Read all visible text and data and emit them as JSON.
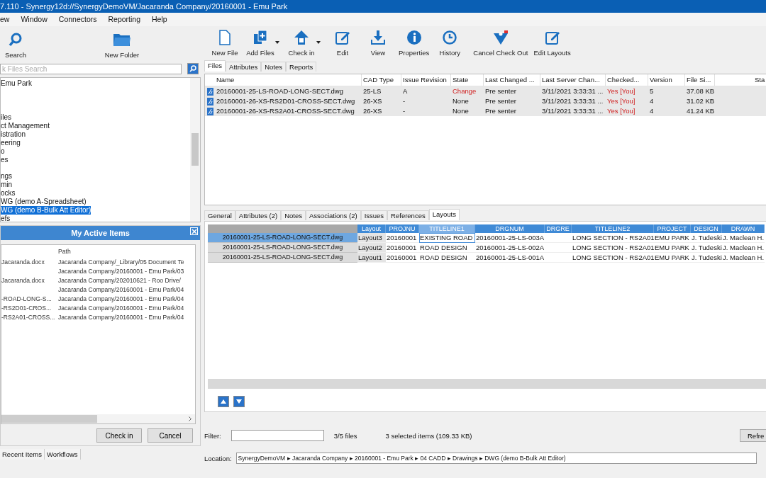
{
  "window": {
    "title": "7.110 - Synergy12d://SynergyDemoVM/Jacaranda Company/20160001 - Emu Park"
  },
  "menu": [
    "ew",
    "Window",
    "Connectors",
    "Reporting",
    "Help"
  ],
  "toolbar_left": [
    {
      "label": "Search",
      "kind": "search"
    },
    {
      "label": "New Folder",
      "kind": "folder"
    }
  ],
  "toolbar": [
    {
      "label": "New File",
      "kind": "file",
      "dropdown": false
    },
    {
      "label": "Add Files",
      "kind": "addfiles",
      "dropdown": true
    },
    {
      "label": "Check in",
      "kind": "checkin",
      "dropdown": true
    },
    {
      "label": "Edit",
      "kind": "edit",
      "dropdown": false
    },
    {
      "label": "View",
      "kind": "download",
      "dropdown": false
    },
    {
      "label": "Properties",
      "kind": "info",
      "dropdown": false
    },
    {
      "label": "History",
      "kind": "history",
      "dropdown": false
    },
    {
      "label": "Cancel Check Out",
      "kind": "cancel",
      "dropdown": false
    },
    {
      "label": "Edit Layouts",
      "kind": "edit",
      "dropdown": false
    }
  ],
  "quick_search": {
    "placeholder": "k Files Search"
  },
  "tree": [
    {
      "label": "Emu Park",
      "selected": false
    },
    {
      "label": "iles",
      "selected": false
    },
    {
      "label": "ct Management",
      "selected": false
    },
    {
      "label": "istration",
      "selected": false
    },
    {
      "label": "eering",
      "selected": false
    },
    {
      "label": "o",
      "selected": false
    },
    {
      "label": "es",
      "selected": false
    },
    {
      "label": "ngs",
      "selected": false
    },
    {
      "label": "min",
      "selected": false
    },
    {
      "label": "ocks",
      "selected": false
    },
    {
      "label": "WG (demo A-Spreadsheet)",
      "selected": false
    },
    {
      "label": "WG (demo B-Bulk Att Editor)",
      "selected": true
    },
    {
      "label": "efs",
      "selected": false
    }
  ],
  "active_items": {
    "title": "My Active Items",
    "columns": [
      "Path"
    ],
    "rows": [
      {
        "name": "Jacaranda.docx",
        "path": "Jacaranda Company/_Library/05 Document Te"
      },
      {
        "path": "Jacaranda Company/20160001 - Emu Park/03"
      },
      {
        "name": "Jacaranda.docx",
        "path": "Jacaranda Company/202010621 - Roo Drive/"
      },
      {
        "path": "Jacaranda Company/20160001 - Emu Park/04"
      },
      {
        "name": "-ROAD-LONG-S...",
        "path": "Jacaranda Company/20160001 - Emu Park/04"
      },
      {
        "name": "-RS2D01-CROS...",
        "path": "Jacaranda Company/20160001 - Emu Park/04"
      },
      {
        "name": "-RS2A01-CROSS...",
        "path": "Jacaranda Company/20160001 - Emu Park/04"
      }
    ],
    "buttons": [
      "Check in",
      "Cancel"
    ]
  },
  "left_tabs": [
    {
      "label": "Recent Items",
      "selected": false
    },
    {
      "label": "Workflows",
      "selected": false
    }
  ],
  "file_tabs": [
    {
      "label": "Files",
      "selected": true
    },
    {
      "label": "Attributes",
      "selected": false
    },
    {
      "label": "Notes",
      "selected": false
    },
    {
      "label": "Reports",
      "selected": false
    }
  ],
  "files": {
    "columns": [
      "Name",
      "CAD Type",
      "Issue Revision",
      "State",
      "Last Changed ...",
      "Last Server Chan...",
      "Checked...",
      "Version",
      "File Si...",
      "Sta"
    ],
    "rows": [
      {
        "selected": true,
        "state_changed": true,
        "cells": [
          "20160001-25-LS-ROAD-LONG-SECT.dwg",
          "25-LS",
          "A",
          "Change",
          "Pre senter",
          "3/11/2021 3:33:31 ...",
          "Yes [You]",
          "5",
          "37.08 KB"
        ]
      },
      {
        "selected": true,
        "state_changed": false,
        "cells": [
          "20160001-26-XS-RS2D01-CROSS-SECT.dwg",
          "26-XS",
          "-",
          "None",
          "Pre senter",
          "3/11/2021 3:33:31 ...",
          "Yes [You]",
          "4",
          "31.02 KB"
        ]
      },
      {
        "selected": true,
        "state_changed": false,
        "cells": [
          "20160001-26-XS-RS2A01-CROSS-SECT.dwg",
          "26-XS",
          "-",
          "None",
          "Pre senter",
          "3/11/2021 3:33:31 ...",
          "Yes [You]",
          "4",
          "41.24 KB"
        ]
      }
    ]
  },
  "detail_tabs": [
    {
      "label": "General",
      "selected": false
    },
    {
      "label": "Attributes (2)",
      "selected": false
    },
    {
      "label": "Notes",
      "selected": false
    },
    {
      "label": "Associations (2)",
      "selected": false
    },
    {
      "label": "Issues",
      "selected": false
    },
    {
      "label": "References",
      "selected": false
    },
    {
      "label": "Layouts",
      "selected": true
    }
  ],
  "layouts": {
    "columns": [
      "Layout",
      "PROJNU",
      "TITLELINE1",
      "DRGNUM",
      "DRGRE",
      "TITLELINE2",
      "PROJECT",
      "DESIGN",
      "DRAWN"
    ],
    "rows": [
      {
        "selected": true,
        "file": "20160001-25-LS-ROAD-LONG-SECT.dwg",
        "cells": [
          "Layout3",
          "20160001",
          "EXISTING ROAD",
          "20160001-25-LS-003A",
          "",
          "LONG SECTION - RS2A01",
          "EMU PARK",
          "J. Tudeski",
          "J. Maclean H."
        ]
      },
      {
        "selected": false,
        "file": "20160001-25-LS-ROAD-LONG-SECT.dwg",
        "cells": [
          "Layout2",
          "20160001",
          "ROAD DESIGN",
          "20160001-25-LS-002A",
          "",
          "LONG SECTION - RS2A01",
          "EMU PARK",
          "J. Tudeski",
          "J. Maclean H."
        ]
      },
      {
        "selected": false,
        "file": "20160001-25-LS-ROAD-LONG-SECT.dwg",
        "cells": [
          "Layout1",
          "20160001",
          "ROAD DESIGN",
          "20160001-25-LS-001A",
          "",
          "LONG SECTION - RS2A01",
          "EMU PARK",
          "J. Tudeski",
          "J. Maclean H."
        ]
      }
    ]
  },
  "filter": {
    "label": "Filter:",
    "count": "3/5 files",
    "selection": "3 selected items (109.33 KB)",
    "button": "Refre"
  },
  "location": {
    "label": "Location:",
    "value": "SynergyDemoVM ▸ Jacaranda Company ▸ 20160001 - Emu Park ▸ 04 CADD ▸ Drawings ▸ DWG (demo B-Bulk Att Editor)"
  }
}
